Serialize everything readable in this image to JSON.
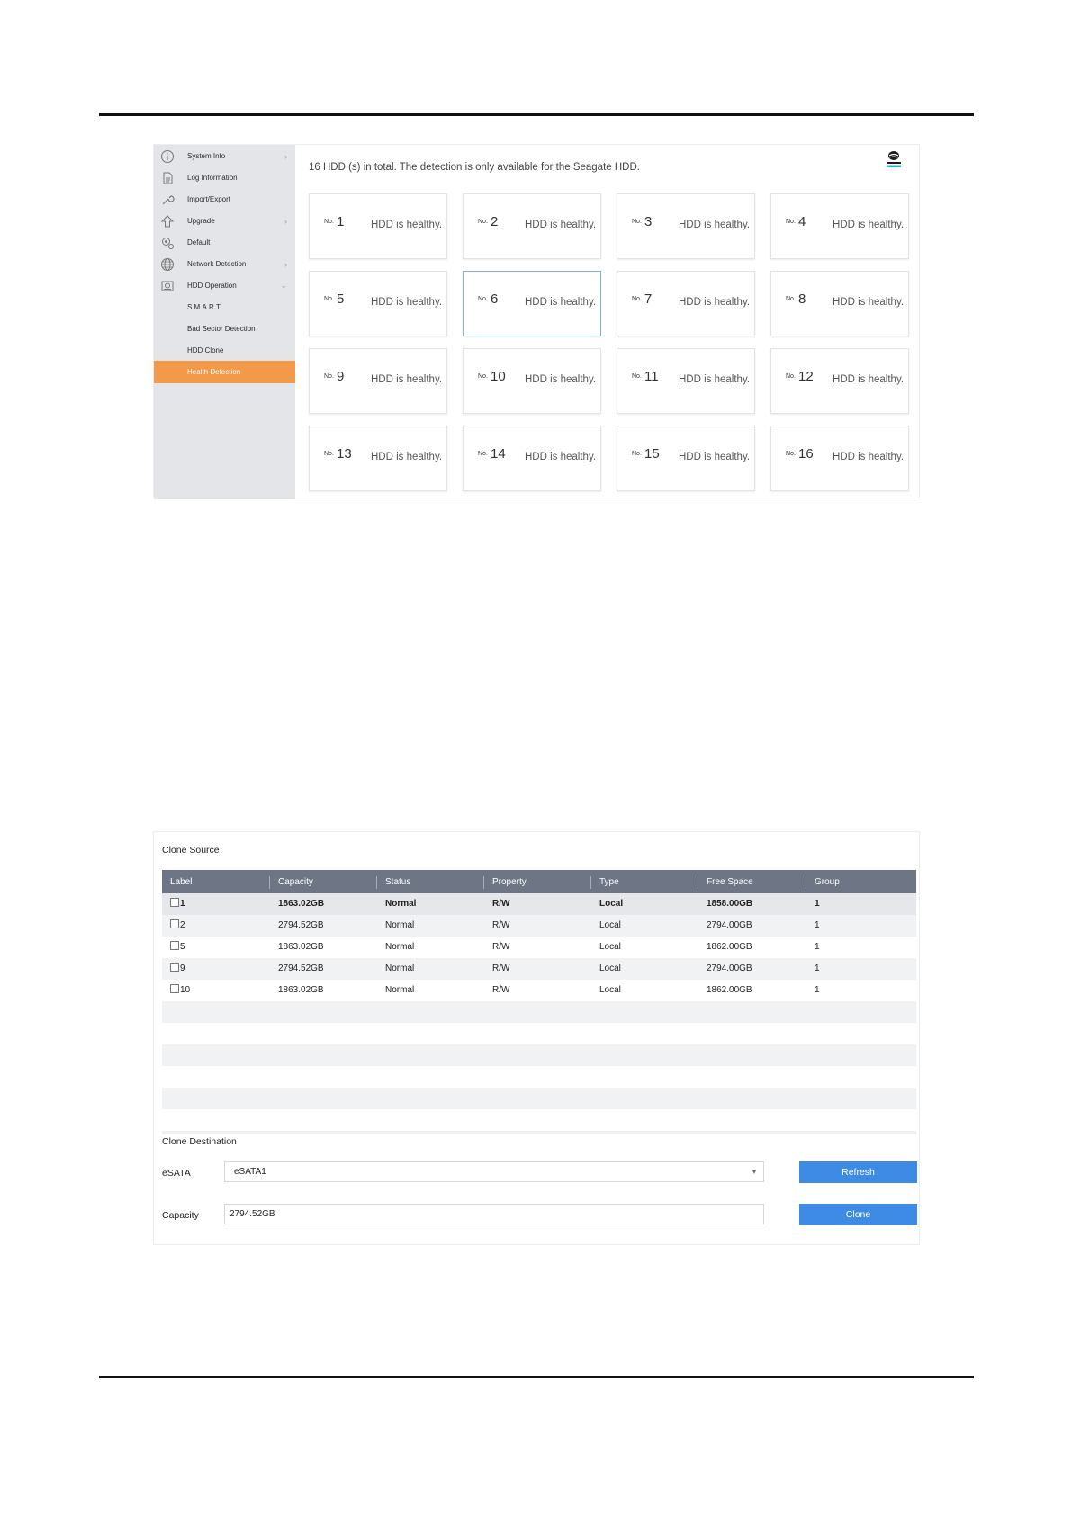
{
  "sidebar": {
    "items": [
      {
        "label": "System Info",
        "icon": "info-icon",
        "arrow": "›"
      },
      {
        "label": "Log Information",
        "icon": "document-icon",
        "arrow": ""
      },
      {
        "label": "Import/Export",
        "icon": "wrench-icon",
        "arrow": ""
      },
      {
        "label": "Upgrade",
        "icon": "upload-arrow-icon",
        "arrow": "›"
      },
      {
        "label": "Default",
        "icon": "reset-gear-icon",
        "arrow": ""
      },
      {
        "label": "Network Detection",
        "icon": "globe-icon",
        "arrow": "›"
      },
      {
        "label": "HDD Operation",
        "icon": "hdd-icon",
        "arrow": "⌄"
      },
      {
        "label": "S.M.A.R.T",
        "icon": "",
        "arrow": ""
      },
      {
        "label": "Bad Sector Detection",
        "icon": "",
        "arrow": ""
      },
      {
        "label": "HDD Clone",
        "icon": "",
        "arrow": ""
      },
      {
        "label": "Health Detection",
        "icon": "",
        "arrow": "",
        "active": true
      }
    ]
  },
  "health": {
    "summary": "16 HDD (s) in total. The detection is only available for the Seagate HDD.",
    "logo": "seagate-skyhawk-logo-icon",
    "no_prefix": "No.",
    "selected_index": 6,
    "cards": [
      {
        "num": "1",
        "status": "HDD is healthy."
      },
      {
        "num": "2",
        "status": "HDD is healthy."
      },
      {
        "num": "3",
        "status": "HDD is healthy."
      },
      {
        "num": "4",
        "status": "HDD is healthy."
      },
      {
        "num": "5",
        "status": "HDD is healthy."
      },
      {
        "num": "6",
        "status": "HDD is healthy."
      },
      {
        "num": "7",
        "status": "HDD is healthy."
      },
      {
        "num": "8",
        "status": "HDD is healthy."
      },
      {
        "num": "9",
        "status": "HDD is healthy."
      },
      {
        "num": "10",
        "status": "HDD is healthy."
      },
      {
        "num": "11",
        "status": "HDD is healthy."
      },
      {
        "num": "12",
        "status": "HDD is healthy."
      },
      {
        "num": "13",
        "status": "HDD is healthy."
      },
      {
        "num": "14",
        "status": "HDD is healthy."
      },
      {
        "num": "15",
        "status": "HDD is healthy."
      },
      {
        "num": "16",
        "status": "HDD is healthy."
      }
    ]
  },
  "clone": {
    "source_title": "Clone Source",
    "headers": [
      "Label",
      "Capacity",
      "Status",
      "Property",
      "Type",
      "Free Space",
      "Group"
    ],
    "rows": [
      [
        "1",
        "1863.02GB",
        "Normal",
        "R/W",
        "Local",
        "1858.00GB",
        "1"
      ],
      [
        "2",
        "2794.52GB",
        "Normal",
        "R/W",
        "Local",
        "2794.00GB",
        "1"
      ],
      [
        "5",
        "1863.02GB",
        "Normal",
        "R/W",
        "Local",
        "1862.00GB",
        "1"
      ],
      [
        "9",
        "2794.52GB",
        "Normal",
        "R/W",
        "Local",
        "2794.00GB",
        "1"
      ],
      [
        "10",
        "1863.02GB",
        "Normal",
        "R/W",
        "Local",
        "1862.00GB",
        "1"
      ]
    ],
    "dest_title": "Clone Destination",
    "esata_label": "eSATA",
    "esata_value": "eSATA1",
    "capacity_label": "Capacity",
    "capacity_value": "2794.52GB",
    "refresh_label": "Refresh",
    "clone_label": "Clone"
  },
  "colors": {
    "accent_orange": "#f2994a",
    "button_blue": "#3d8be5",
    "table_header": "#6e7686"
  }
}
